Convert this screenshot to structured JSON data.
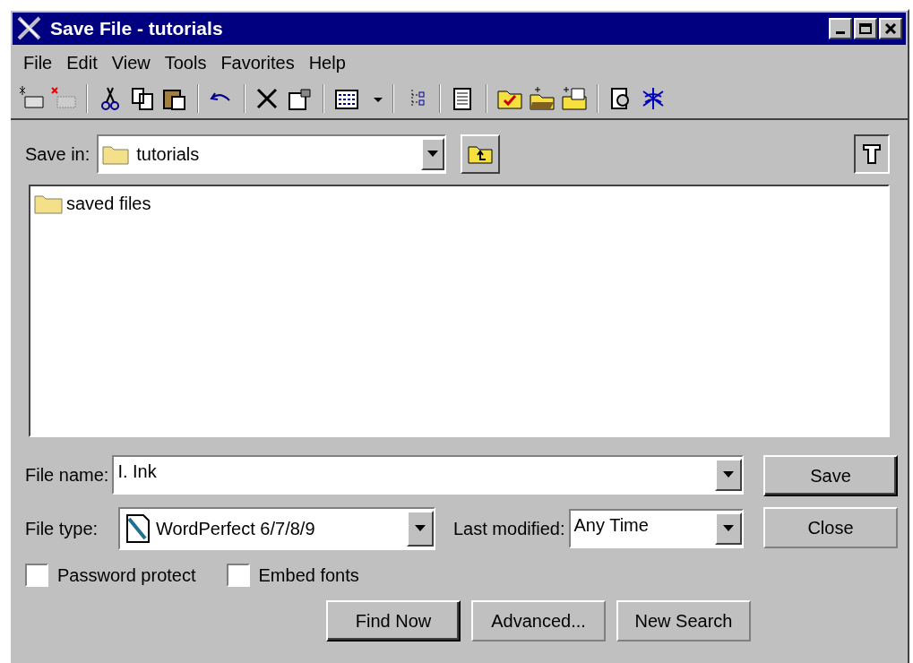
{
  "window": {
    "title": "Save File - tutorials"
  },
  "menu": [
    "File",
    "Edit",
    "View",
    "Tools",
    "Favorites",
    "Help"
  ],
  "save_in": {
    "label": "Save in:",
    "value": "tutorials"
  },
  "files": [
    {
      "name": "saved files"
    }
  ],
  "file_name": {
    "label": "File name:",
    "value": "I. Ink"
  },
  "file_type": {
    "label": "File type:",
    "value": "WordPerfect 6/7/8/9"
  },
  "last_modified": {
    "label": "Last modified:",
    "value": "Any Time"
  },
  "options": [
    {
      "label": "Password protect",
      "checked": false
    },
    {
      "label": "Embed fonts",
      "checked": false
    }
  ],
  "side_buttons": [
    {
      "label": "Save",
      "default": true
    },
    {
      "label": "Close",
      "default": false
    }
  ],
  "search_buttons": [
    {
      "label": "Find Now",
      "default": true
    },
    {
      "label": "Advanced...",
      "default": false
    },
    {
      "label": "New Search",
      "default": false
    }
  ]
}
